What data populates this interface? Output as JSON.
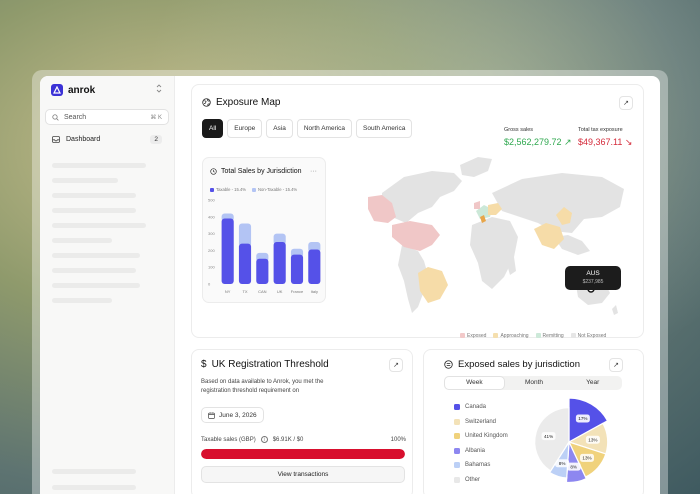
{
  "brand": {
    "name": "anrok"
  },
  "sidebar": {
    "search_label": "Search",
    "search_shortcut": "⌘ K",
    "nav": [
      {
        "label": "Dashboard",
        "count": "2"
      }
    ]
  },
  "exposure_map": {
    "title": "Exposure Map",
    "filters": [
      "All",
      "Europe",
      "Asia",
      "North America",
      "South America"
    ],
    "active_filter": "All",
    "gross_sales": {
      "label": "Gross sales",
      "value": "$2,562,279.72 ↗",
      "color": "#2fa84f"
    },
    "total_tax": {
      "label": "Total tax exposure",
      "value": "$49,367.11 ↘",
      "color": "#d42a3a"
    },
    "tooltip": {
      "country": "AUS",
      "amount": "$237,985"
    },
    "legend": [
      {
        "label": "Exposed",
        "color": "#f2c9c9"
      },
      {
        "label": "Approaching",
        "color": "#f5dfae"
      },
      {
        "label": "Remitting",
        "color": "#cde9d9"
      },
      {
        "label": "Not Exposed",
        "color": "#e6e6e6"
      }
    ],
    "map_colors": {
      "base": "#e3e3e3",
      "exposed": "#f0c7c7",
      "approaching": "#f6dca8",
      "remitting": "#cce8d8",
      "accent": "#e8a64a"
    }
  },
  "sales_chart": {
    "title": "Total Sales by Jurisdiction",
    "legend": [
      "Taxable - 15.4%",
      "Non-Taxable - 15.4%"
    ]
  },
  "chart_data": {
    "type": "bar",
    "categories": [
      "NY",
      "TX",
      "CAN",
      "UK",
      "France",
      "Italy"
    ],
    "series": [
      {
        "name": "Taxable - 15.4%",
        "values": [
          390,
          240,
          150,
          250,
          175,
          205
        ],
        "color": "#5551e8"
      },
      {
        "name": "Non-Taxable - 15.4%",
        "values": [
          30,
          120,
          35,
          50,
          35,
          45
        ],
        "color": "#b3c4f4"
      }
    ],
    "ylim": [
      0,
      500
    ],
    "yticks": [
      "500",
      "400",
      "300",
      "200",
      "100",
      "0"
    ]
  },
  "uk_threshold": {
    "title": "UK Registration Threshold",
    "description": "Based on data available to Anrok, you met the registration threshold requirement on",
    "date": "June 3, 2026",
    "sales_label": "Taxable sales (GBP)",
    "sales_value": "$6.91K / $0",
    "percent_label": "100%",
    "progress": 1.0,
    "button_label": "View transactions"
  },
  "exposed_sales": {
    "title": "Exposed sales by jurisdiction",
    "tabs": [
      "Week",
      "Month",
      "Year"
    ],
    "active_tab": "Week",
    "legend": [
      {
        "label": "Canada",
        "color": "#5551e8"
      },
      {
        "label": "Switzerland",
        "color": "#f3e2b8"
      },
      {
        "label": "United Kingdom",
        "color": "#f0d27c"
      },
      {
        "label": "Albania",
        "color": "#8d87f0"
      },
      {
        "label": "Bahamas",
        "color": "#bcd0f6"
      },
      {
        "label": "Other",
        "color": "#e8e8e8"
      }
    ],
    "pie": [
      {
        "label": "17%",
        "value": 17,
        "color": "#5551e8",
        "r": 1.0
      },
      {
        "label": "13%",
        "value": 13,
        "color": "#f3e2b8",
        "r": 0.88
      },
      {
        "label": "13%",
        "value": 13,
        "color": "#f0d27c",
        "r": 0.88
      },
      {
        "label": "8%",
        "value": 8,
        "color": "#8d87f0",
        "r": 0.92
      },
      {
        "label": "8%",
        "value": 8,
        "color": "#bcd0f6",
        "r": 0.82
      },
      {
        "label": "41%",
        "value": 41,
        "color": "#ebebeb",
        "r": 0.78
      }
    ]
  }
}
